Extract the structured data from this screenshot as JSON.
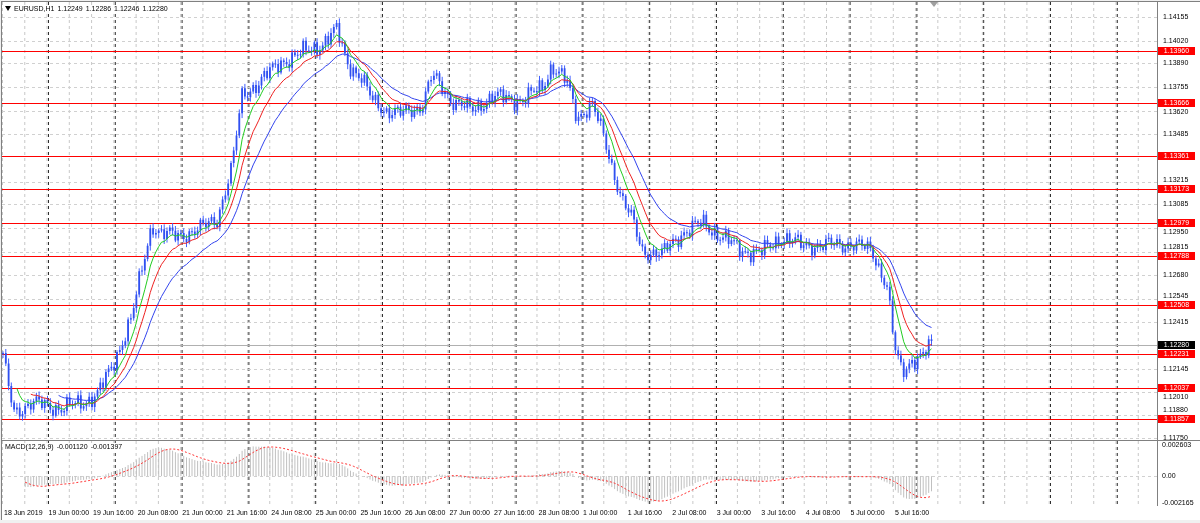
{
  "header": {
    "symbol": "EURUSD,H1",
    "open": "1.12249",
    "high": "1.12286",
    "low": "1.12246",
    "close": "1.12280"
  },
  "price_axis": {
    "ticks": [
      "1.14155",
      "1.14020",
      "1.13890",
      "1.13755",
      "1.13620",
      "1.13485",
      "1.13215",
      "1.13085",
      "1.12950",
      "1.12815",
      "1.12680",
      "1.12545",
      "1.12415",
      "1.12145",
      "1.12010",
      "1.11880",
      "1.11750"
    ]
  },
  "level_lines": [
    "1.13960",
    "1.13666",
    "1.13361",
    "1.13173",
    "1.12979",
    "1.12788",
    "1.12508",
    "1.12231",
    "1.12037",
    "1.11857"
  ],
  "current_price": "1.12280",
  "macd": {
    "name": "MACD(12,26,9)",
    "main": "-0.001120",
    "signal": "-0.001397",
    "axis": [
      "0.002603",
      "0.00",
      "-0.002165"
    ]
  },
  "time_axis": [
    "18 Jun 2019",
    "19 Jun 00:00",
    "19 Jun 16:00",
    "20 Jun 08:00",
    "21 Jun 00:00",
    "21 Jun 16:00",
    "24 Jun 08:00",
    "25 Jun 00:00",
    "25 Jun 16:00",
    "26 Jun 08:00",
    "27 Jun 00:00",
    "27 Jun 16:00",
    "28 Jun 08:00",
    "1 Jul 00:00",
    "1 Jul 16:00",
    "2 Jul 08:00",
    "3 Jul 00:00",
    "3 Jul 16:00",
    "4 Jul 08:00",
    "5 Jul 00:00",
    "5 Jul 16:00"
  ]
}
